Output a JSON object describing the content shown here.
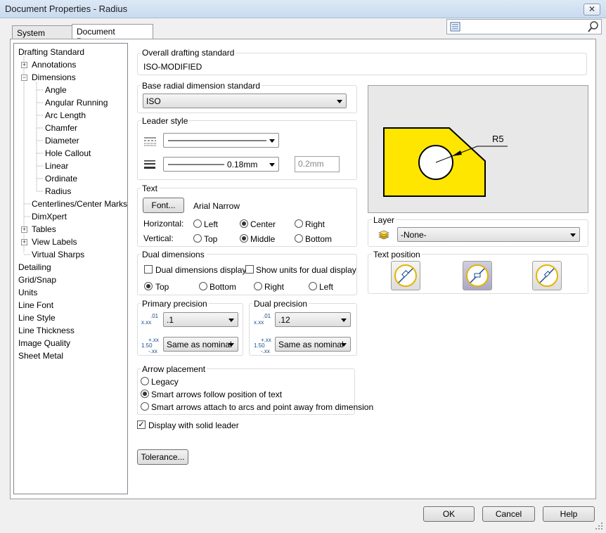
{
  "window": {
    "title": "Document Properties - Radius",
    "close": "✕"
  },
  "tabs": [
    {
      "label": "System Options"
    },
    {
      "label": "Document Properties"
    }
  ],
  "tree": [
    {
      "label": "Drafting Standard"
    },
    {
      "label": "Annotations",
      "expander": "+"
    },
    {
      "label": "Dimensions",
      "expander": "−"
    },
    {
      "label": "Angle"
    },
    {
      "label": "Angular Running"
    },
    {
      "label": "Arc Length"
    },
    {
      "label": "Chamfer"
    },
    {
      "label": "Diameter"
    },
    {
      "label": "Hole Callout"
    },
    {
      "label": "Linear"
    },
    {
      "label": "Ordinate"
    },
    {
      "label": "Radius"
    },
    {
      "label": "Centerlines/Center Marks"
    },
    {
      "label": "DimXpert"
    },
    {
      "label": "Tables",
      "expander": "+"
    },
    {
      "label": "View Labels",
      "expander": "+"
    },
    {
      "label": "Virtual Sharps"
    },
    {
      "label": "Detailing"
    },
    {
      "label": "Grid/Snap"
    },
    {
      "label": "Units"
    },
    {
      "label": "Line Font"
    },
    {
      "label": "Line Style"
    },
    {
      "label": "Line Thickness"
    },
    {
      "label": "Image Quality"
    },
    {
      "label": "Sheet Metal"
    }
  ],
  "overall": {
    "label": "Overall drafting standard",
    "value": "ISO-MODIFIED"
  },
  "base_radial": {
    "label": "Base radial dimension standard",
    "value": "ISO"
  },
  "leader_style": {
    "label": "Leader style",
    "thickness_value": "0.18mm",
    "custom_thickness": "0.2mm"
  },
  "text": {
    "label": "Text",
    "font_button": "Font...",
    "font_name": "Arial Narrow",
    "horizontal_label": "Horizontal:",
    "vertical_label": "Vertical:",
    "h_left": "Left",
    "h_center": "Center",
    "h_right": "Right",
    "v_top": "Top",
    "v_middle": "Middle",
    "v_bottom": "Bottom",
    "horizontal_selected": "Center",
    "vertical_selected": "Middle"
  },
  "dual": {
    "label": "Dual dimensions",
    "display": "Dual dimensions display",
    "show_units": "Show units for dual display",
    "top": "Top",
    "bottom": "Bottom",
    "right": "Right",
    "left": "Left",
    "selected": "Top"
  },
  "primary_precision": {
    "label": "Primary precision",
    "value": ".1",
    "tolerance": "Same as nominal"
  },
  "dual_precision": {
    "label": "Dual precision",
    "value": ".12",
    "tolerance": "Same as nominal"
  },
  "precision_icons": {
    "value_top": ".01",
    "value_main": "x.xx",
    "tol_top": "+.xx",
    "tol_main": "1.50",
    "tol_bottom": "-.xx"
  },
  "arrow": {
    "label": "Arrow placement",
    "legacy": "Legacy",
    "smart_follow": "Smart arrows follow position of text",
    "smart_attach": "Smart arrows attach to arcs and point away from dimension",
    "selected": "Smart arrows follow position of text"
  },
  "solid_leader": {
    "label": "Display with solid leader",
    "checked": true
  },
  "tolerance_button": "Tolerance...",
  "preview": {
    "dim_text": "R5",
    "part_color": "#ffe600"
  },
  "layer": {
    "label": "Layer",
    "value": "-None-"
  },
  "text_position": {
    "label": "Text position"
  },
  "footer": {
    "ok": "OK",
    "cancel": "Cancel",
    "help": "Help"
  },
  "icons": {
    "search": "search-icon",
    "list": "list-icon",
    "layer": "layer-icon",
    "hatch": "line-style-icon",
    "thickness": "line-thickness-icon"
  }
}
